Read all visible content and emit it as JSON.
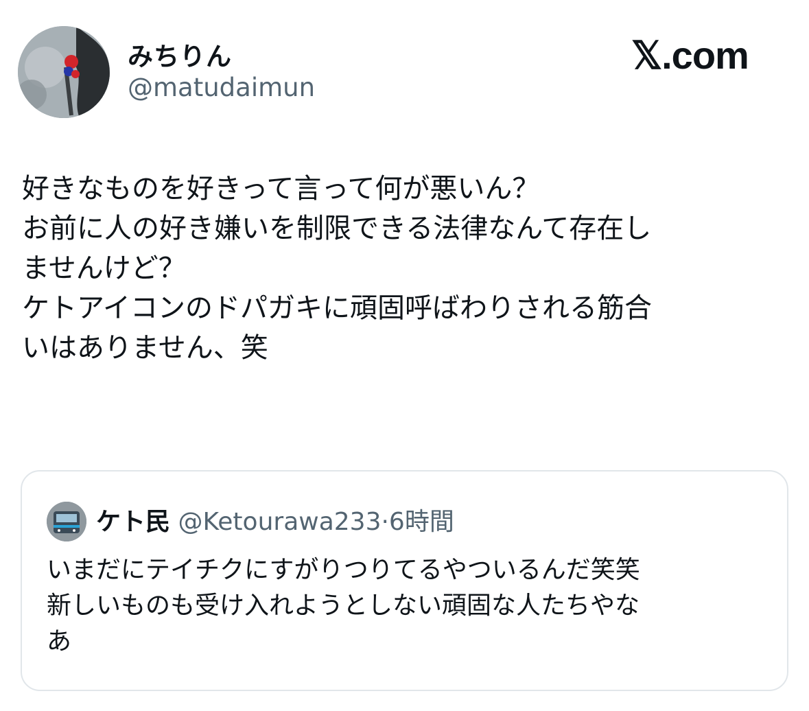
{
  "author": {
    "display_name": "みちりん",
    "handle": "@matudaimun"
  },
  "brand": {
    "logo_text": "𝕏.com",
    "icon": "x-logo-icon"
  },
  "tweet": {
    "text": "好きなものを好きって言って何が悪いん？\nお前に人の好き嫌いを制限できる法律なんて存在し\nませんけど？\nケトアイコンのドパガキに頑固呼ばわりされる筋合\nいはありません、笑"
  },
  "quote": {
    "display_name": "ケト民",
    "handle": "@Ketourawa233",
    "separator": "·",
    "time": "6時間",
    "text": "いまだにテイチクにすがりつりてるやついるんだ笑笑\n新しいものも受け入れようとしない頑固な人たちやな\nあ"
  },
  "colors": {
    "text_primary": "#0f1419",
    "text_secondary": "#536471",
    "border": "#e1e6ea"
  }
}
